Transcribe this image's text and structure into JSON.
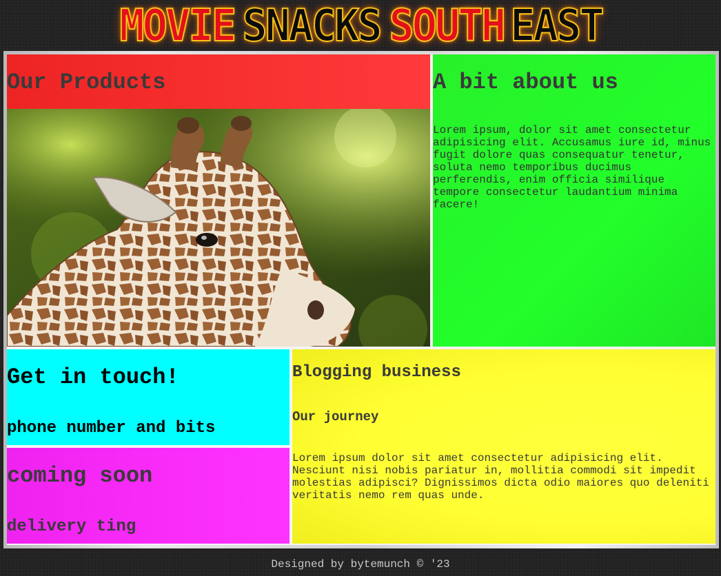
{
  "header": {
    "logo_words": [
      "MOVIE",
      "SNACKS",
      "SOUTH",
      "EAST"
    ],
    "logo_colors": [
      "#e4101a",
      "#0c0c0c",
      "#e4101a",
      "#0c0c0c"
    ]
  },
  "products": {
    "title": "Our Products",
    "image": "giraffe-photo"
  },
  "about": {
    "title": "A bit about us",
    "body": "Lorem ipsum, dolor sit amet consectetur adipisicing elit. Accusamus iure id, minus fugit dolore quas consequatur tenetur, soluta nemo temporibus ducimus perferendis, enim officia similique tempore consectetur laudantium minima facere!"
  },
  "contact": {
    "title": "Get in touch!",
    "subtitle": "phone number and bits"
  },
  "coming": {
    "title": "coming soon",
    "subtitle": "delivery ting"
  },
  "blog": {
    "title": "Blogging business",
    "subtitle": "Our journey",
    "body": "Lorem ipsum dolor sit amet consectetur adipisicing elit. Nesciunt nisi nobis pariatur in, mollitia commodi sit impedit molestias adipisci? Dignissimos dicta odio maiores quo deleniti veritatis nemo rem quas unde."
  },
  "colors": {
    "products_header": "#ff3333",
    "about_bg": "#22ff2a",
    "contact_bg": "#00ffff",
    "coming_bg": "#ff33ff",
    "blog_bg": "#ffff33",
    "page_bg": "#222222"
  },
  "footer": {
    "credit": "Designed by bytemunch © '23"
  }
}
